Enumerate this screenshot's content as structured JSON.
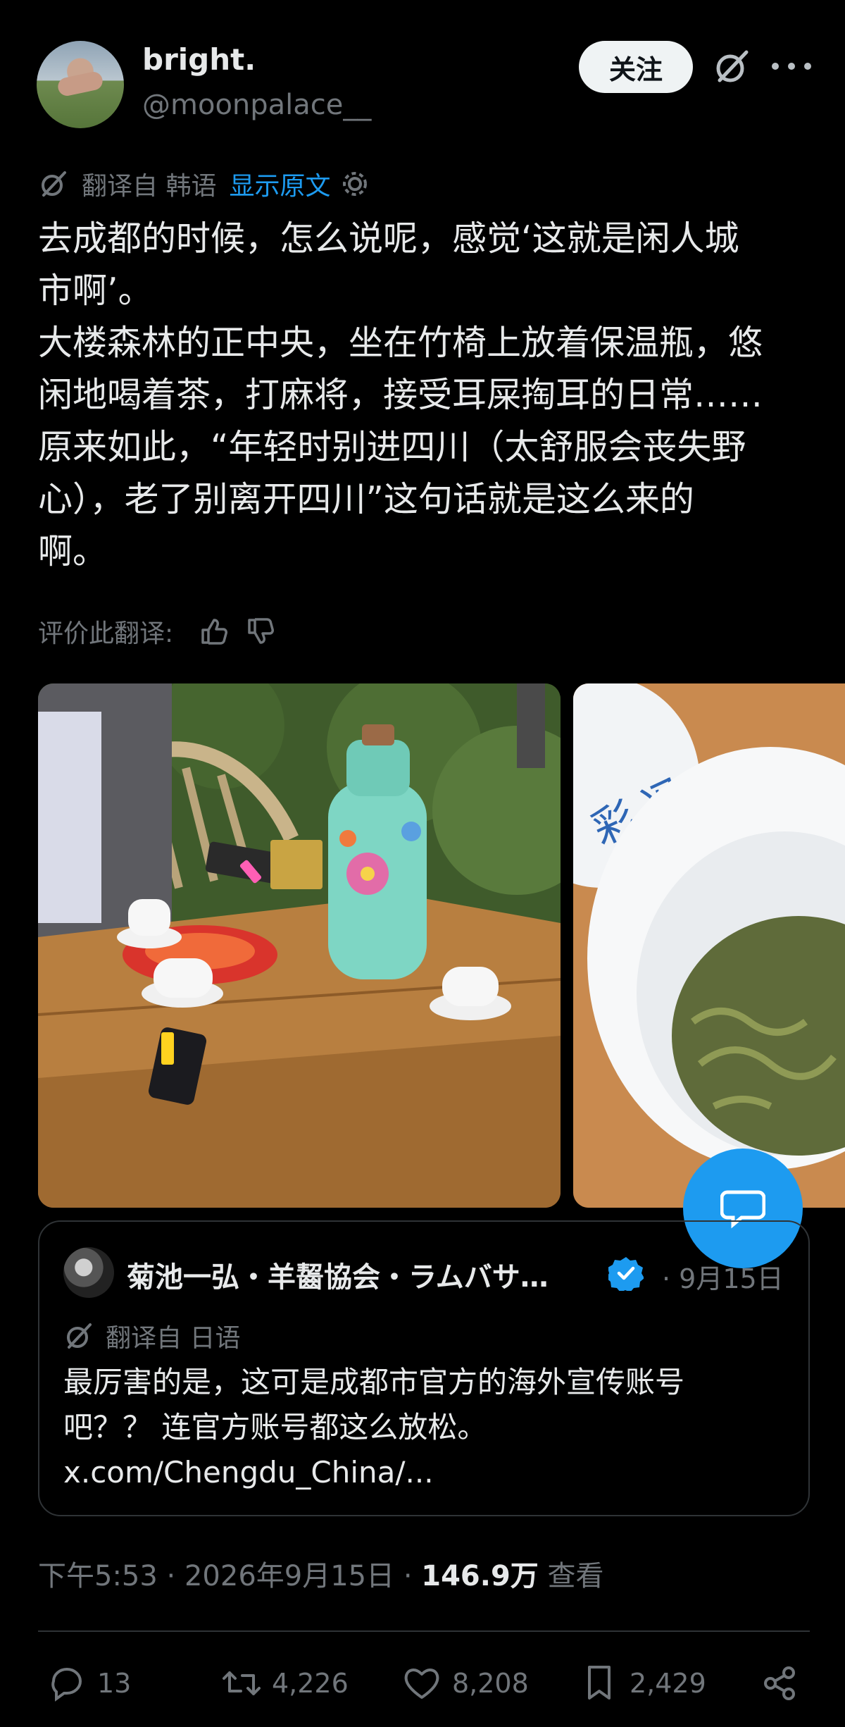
{
  "author": {
    "display_name": "bright.",
    "handle": "@moonpalace__"
  },
  "header": {
    "follow_label": "关注"
  },
  "translation": {
    "from_text": "翻译自 韩语",
    "show_original_label": "显示原文"
  },
  "tweet": {
    "lines": [
      "去成都的时候，怎么说呢，感觉‘这就是闲人城",
      "市啊’。",
      "大楼森林的正中央，坐在竹椅上放着保温瓶，悠",
      "闲地喝着茶，打麻将，接受耳屎掏耳的日常……",
      "原来如此，“年轻时别进四川（太舒服会丧失野",
      "心），老了别离开四川”这句话就是这么来的",
      "啊。"
    ]
  },
  "rating": {
    "label": "评价此翻译:"
  },
  "quote": {
    "name": "菊池一弘・羊齧協会・ラムバサ…",
    "date": "· 9月15日",
    "translation_text": "翻译自 日语",
    "text_lines": [
      "最厉害的是，这可是成都市官方的海外宣传账号",
      "吧？？ 连官方账号都这么放松。"
    ],
    "link": "x.com/Chengdu_China/..."
  },
  "meta": {
    "timestamp": "下午5:53 · 2026年9月15日 · ",
    "views_count": "146.9万",
    "views_label": " 查看"
  },
  "actions": {
    "replies": "13",
    "reposts": "4,226",
    "likes": "8,208",
    "bookmarks": "2,429"
  },
  "colors": {
    "background": "#000000",
    "text": "#e7e9ea",
    "muted": "#71767b",
    "accent": "#1d9bf0",
    "border": "#2f3336"
  },
  "icons": {
    "grok": "grok-icon",
    "more": "more-icon",
    "translate": "translate-icon",
    "settings": "gear-icon",
    "thumbs_up": "thumbs-up-icon",
    "thumbs_down": "thumbs-down-icon",
    "verified": "verified-badge-icon",
    "reply": "reply-icon",
    "repost": "repost-icon",
    "like": "heart-icon",
    "bookmark": "bookmark-icon",
    "compose": "compose-icon"
  }
}
